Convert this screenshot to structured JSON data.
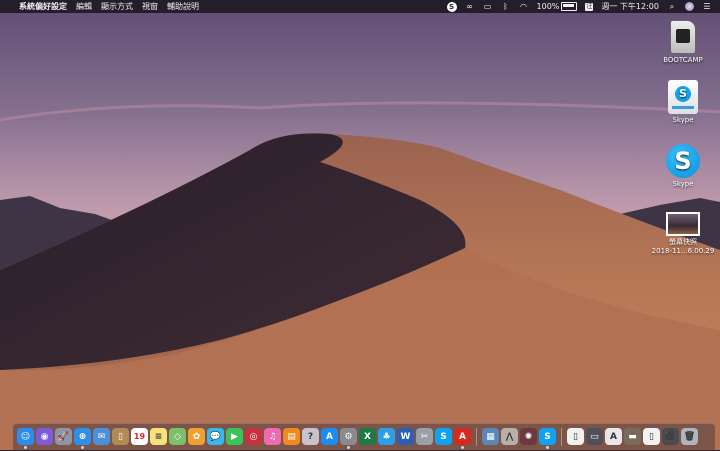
{
  "menubar": {
    "apple_glyph": "",
    "app_name": "系統偏好設定",
    "menus": [
      "編輯",
      "顯示方式",
      "視窗",
      "輔助說明"
    ],
    "battery_percent": "100%",
    "ime_label": "注",
    "clock": "週一 下午12:00",
    "tray_icons": [
      "skype-icon",
      "creative-cloud-icon",
      "airplay-icon",
      "bluetooth-icon",
      "wifi-icon",
      "battery-icon",
      "input-method-icon",
      "search-icon",
      "siri-icon",
      "notification-center-icon"
    ]
  },
  "desktop": {
    "icons": [
      {
        "label": "BOOTCAMP",
        "icon": "sd-card-icon"
      },
      {
        "label": "Skype",
        "icon": "skype-disk-image-icon"
      },
      {
        "label": "Skype",
        "icon": "skype-app-icon"
      },
      {
        "label": "螢幕快照\n2018-11...6.00.29",
        "icon": "screenshot-file-icon"
      }
    ]
  },
  "dock": {
    "items": [
      {
        "name": "finder",
        "color": "#2b8cf0",
        "glyph": "☺",
        "running": true
      },
      {
        "name": "siri",
        "color": "#7b5cd6",
        "glyph": "◉",
        "running": false
      },
      {
        "name": "launchpad",
        "color": "#8c96a8",
        "glyph": "🚀",
        "running": false
      },
      {
        "name": "safari",
        "color": "#2f8fe6",
        "glyph": "⊕",
        "running": true
      },
      {
        "name": "mail",
        "color": "#4a90d9",
        "glyph": "✉",
        "running": false
      },
      {
        "name": "contacts",
        "color": "#b38a55",
        "glyph": "▯",
        "running": false
      },
      {
        "name": "calendar",
        "color": "#ffffff",
        "glyph": "19",
        "running": false
      },
      {
        "name": "notes",
        "color": "#f5e27a",
        "glyph": "≡",
        "running": false
      },
      {
        "name": "maps",
        "color": "#7dbf6a",
        "glyph": "◇",
        "running": false
      },
      {
        "name": "photos",
        "color": "#f0a030",
        "glyph": "✿",
        "running": false
      },
      {
        "name": "messages",
        "color": "#33b8f0",
        "glyph": "💬",
        "running": false
      },
      {
        "name": "facetime",
        "color": "#3cc45a",
        "glyph": "▶",
        "running": false
      },
      {
        "name": "photo-booth",
        "color": "#c83040",
        "glyph": "◎",
        "running": false
      },
      {
        "name": "itunes",
        "color": "#f06ab0",
        "glyph": "♫",
        "running": false
      },
      {
        "name": "books",
        "color": "#f08a20",
        "glyph": "▤",
        "running": false
      },
      {
        "name": "help",
        "color": "#c8c2cc",
        "glyph": "?",
        "running": false
      },
      {
        "name": "app-store",
        "color": "#1d8cf0",
        "glyph": "A",
        "running": false
      },
      {
        "name": "system-preferences",
        "color": "#8a8a90",
        "glyph": "⚙",
        "running": true
      },
      {
        "name": "excel",
        "color": "#1e7a45",
        "glyph": "X",
        "running": false
      },
      {
        "name": "messenger",
        "color": "#2aa0e8",
        "glyph": "♣",
        "running": false
      },
      {
        "name": "word",
        "color": "#2b5fb4",
        "glyph": "W",
        "running": false
      },
      {
        "name": "bootcamp-assistant",
        "color": "#9aa0a8",
        "glyph": "✂",
        "running": false
      },
      {
        "name": "skype",
        "color": "#0fa3ef",
        "glyph": "S",
        "running": false
      },
      {
        "name": "acrobat",
        "color": "#d62a20",
        "glyph": "A",
        "running": true
      },
      {
        "name": "preview",
        "color": "#5a86b8",
        "glyph": "▦",
        "running": false
      },
      {
        "name": "tool",
        "color": "#b8b0a8",
        "glyph": "⋀",
        "running": false
      },
      {
        "name": "photo-app",
        "color": "#6a3a40",
        "glyph": "✺",
        "running": false
      },
      {
        "name": "skype-2",
        "color": "#0fa3ef",
        "glyph": "S",
        "running": true
      },
      {
        "name": "document",
        "color": "#f0f0f0",
        "glyph": "▯",
        "running": false
      },
      {
        "name": "screen-capture",
        "color": "#50505a",
        "glyph": "▭",
        "running": false
      },
      {
        "name": "text-doc",
        "color": "#e8e8e8",
        "glyph": "A",
        "running": false
      },
      {
        "name": "image-file",
        "color": "#7a6a5a",
        "glyph": "▬",
        "running": false
      },
      {
        "name": "blank-file",
        "color": "#f2f2f2",
        "glyph": "▯",
        "running": false
      },
      {
        "name": "downloads",
        "color": "#4a4a52",
        "glyph": "⬛",
        "running": false
      },
      {
        "name": "trash",
        "color": "#b0b4bc",
        "glyph": "🗑",
        "running": false
      }
    ]
  }
}
